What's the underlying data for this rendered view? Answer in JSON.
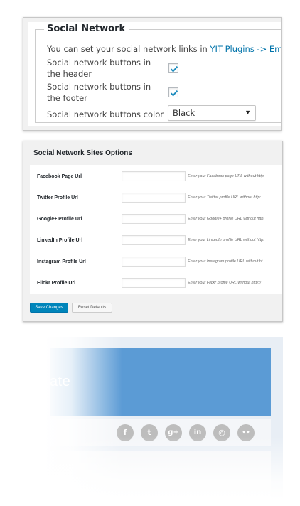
{
  "social_network_panel": {
    "legend": "Social Network",
    "description_prefix": "You can set your social network links in ",
    "description_link": "YIT Plugins -> Email Template",
    "rows": [
      {
        "label": "Social network buttons in the header",
        "checked": true
      },
      {
        "label": "Social network buttons in the footer",
        "checked": true
      }
    ],
    "color_label": "Social network buttons color",
    "color_value": "Black"
  },
  "sites_options": {
    "title": "Social Network Sites Options",
    "fields": [
      {
        "label": "Facebook Page Url",
        "value": "",
        "hint": "Enter your Facebook page URL without http"
      },
      {
        "label": "Twitter Profile Url",
        "value": "",
        "hint": "Enter your Twitter profile URL without http:"
      },
      {
        "label": "Google+ Profile Url",
        "value": "",
        "hint": "Enter your Google+ profile URL without http:"
      },
      {
        "label": "LinkedIn Profile Url",
        "value": "",
        "hint": "Enter your LinkedIn profile URL without http:"
      },
      {
        "label": "Instagram Profile Url",
        "value": "",
        "hint": "Enter your Instagram profile URL without ht"
      },
      {
        "label": "Flickr Profile Url",
        "value": "",
        "hint": "Enter your Flickr profile URL without http://"
      }
    ],
    "save_label": "Save Changes",
    "reset_label": "Reset Defaults"
  },
  "email_preview": {
    "header_text": "ate",
    "header_color": "#5b9bd5",
    "social_icons": [
      {
        "name": "facebook-icon",
        "glyph": "f"
      },
      {
        "name": "twitter-icon",
        "glyph": "t"
      },
      {
        "name": "google-plus-icon",
        "glyph": "g+"
      },
      {
        "name": "linkedin-icon",
        "glyph": "in"
      },
      {
        "name": "instagram-icon",
        "glyph": "◎"
      },
      {
        "name": "flickr-icon",
        "glyph": "••"
      }
    ],
    "icon_color": "#bdbdbd"
  },
  "colors": {
    "link": "#0073aa",
    "primary_button": "#0085ba",
    "checkmark": "#1e8cbe"
  }
}
